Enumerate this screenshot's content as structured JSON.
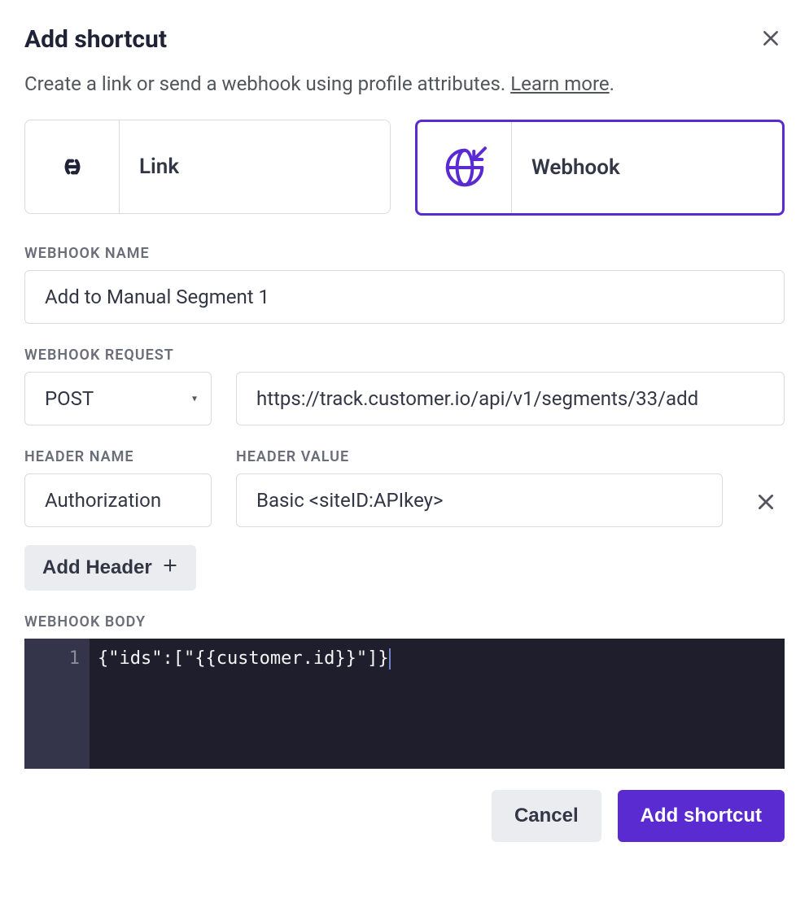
{
  "modal": {
    "title": "Add shortcut",
    "description_prefix": "Create a link or send a webhook using profile attributes. ",
    "learn_more_text": "Learn more",
    "description_suffix": "."
  },
  "types": {
    "link": {
      "label": "Link",
      "selected": false
    },
    "webhook": {
      "label": "Webhook",
      "selected": true
    }
  },
  "webhook_name": {
    "label": "WEBHOOK NAME",
    "value": "Add to Manual Segment 1"
  },
  "webhook_request": {
    "label": "WEBHOOK REQUEST",
    "method": "POST",
    "url": "https://track.customer.io/api/v1/segments/33/add"
  },
  "header": {
    "name_label": "HEADER NAME",
    "value_label": "HEADER VALUE",
    "name": "Authorization",
    "value": "Basic <siteID:APIkey>"
  },
  "add_header_label": "Add Header",
  "webhook_body": {
    "label": "WEBHOOK BODY",
    "line_number": "1",
    "code": "{\"ids\":[\"{{customer.id}}\"]}"
  },
  "footer": {
    "cancel": "Cancel",
    "submit": "Add shortcut"
  }
}
